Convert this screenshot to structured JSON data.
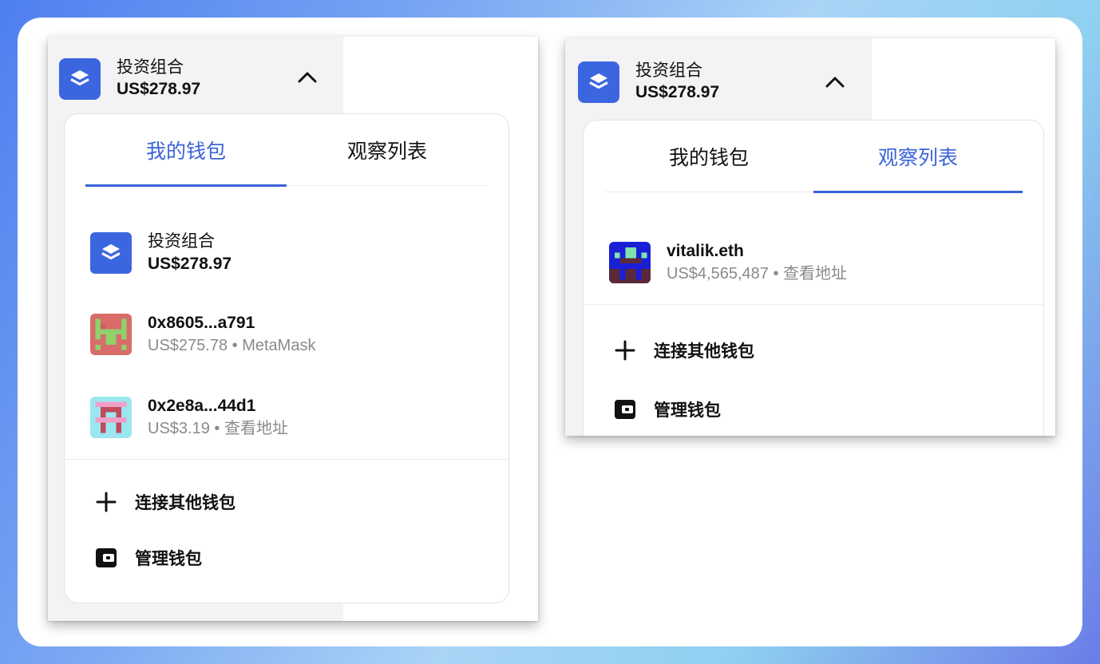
{
  "left_panel": {
    "header": {
      "title": "投资组合",
      "amount": "US$278.97"
    },
    "tabs": [
      {
        "label": "我的钱包",
        "active": true
      },
      {
        "label": "观察列表",
        "active": false
      }
    ],
    "items": [
      {
        "name": "投资组合",
        "sub": "US$278.97",
        "avatar": "portfolio-logo"
      },
      {
        "name": "0x8605...a791",
        "sub": "US$275.78 • MetaMask",
        "avatar": "pixel-avatar-1"
      },
      {
        "name": "0x2e8a...44d1",
        "sub": "US$3.19 • 查看地址",
        "avatar": "pixel-avatar-2"
      }
    ],
    "actions": [
      {
        "label": "连接其他钱包",
        "icon": "plus-icon"
      },
      {
        "label": "管理钱包",
        "icon": "wallet-icon"
      }
    ]
  },
  "right_panel": {
    "header": {
      "title": "投资组合",
      "amount": "US$278.97"
    },
    "tabs": [
      {
        "label": "我的钱包",
        "active": false
      },
      {
        "label": "观察列表",
        "active": true
      }
    ],
    "items": [
      {
        "name": "vitalik.eth",
        "sub": "US$4,565,487 • 查看地址",
        "avatar": "pixel-avatar-3"
      }
    ],
    "actions": [
      {
        "label": "连接其他钱包",
        "icon": "plus-icon"
      },
      {
        "label": "管理钱包",
        "icon": "wallet-icon"
      }
    ]
  },
  "colors": {
    "accent": "#3a63d8",
    "logo_bg": "#3c66e0",
    "muted_text": "#8a8a8f"
  }
}
